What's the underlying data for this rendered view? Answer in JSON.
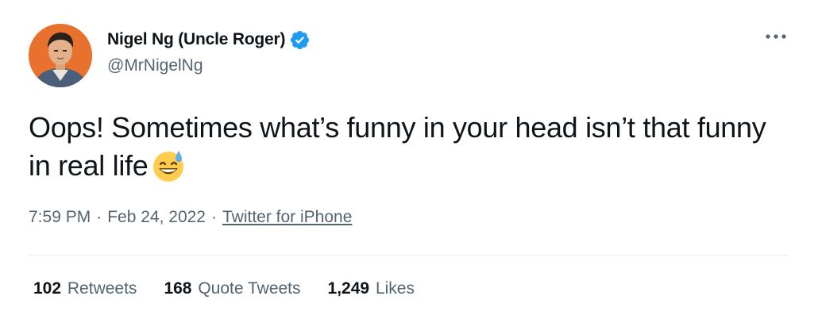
{
  "author": {
    "name": "Nigel Ng (Uncle Roger)",
    "handle": "@MrNigelNg"
  },
  "tweet": {
    "text": "Oops! Sometimes what’s funny in your head isn’t that funny in real life",
    "emoji": "grinning-face-with-sweat"
  },
  "meta": {
    "time": "7:59 PM",
    "separator": "·",
    "date": "Feb 24, 2022",
    "source": "Twitter for iPhone"
  },
  "stats": {
    "retweets_count": "102",
    "retweets_label": "Retweets",
    "quotes_count": "168",
    "quotes_label": "Quote Tweets",
    "likes_count": "1,249",
    "likes_label": "Likes"
  },
  "colors": {
    "verified": "#1d9bf0",
    "secondary_text": "#536471",
    "primary_text": "#0f1419",
    "avatar_bg": "#e8722d"
  }
}
